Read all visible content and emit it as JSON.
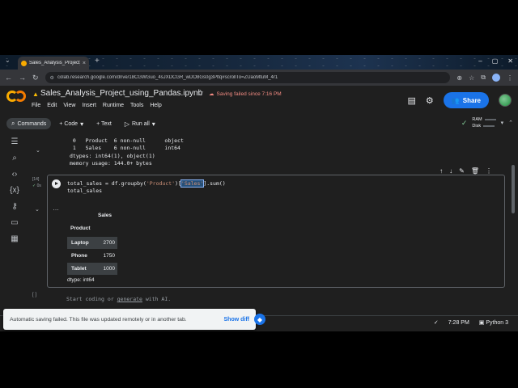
{
  "browser": {
    "tab_title": "Sales_Analysis_Project_using_P",
    "tab_close": "×",
    "new_tab": "+",
    "url": "colab.research.google.com/drive/18CGWGuo_4sJXDCGR_wDO8Gs0g3Pltq#scrollTo=ZUaoMtuM_4r1"
  },
  "header": {
    "notebook_title": "Sales_Analysis_Project_using_Pandas.ipynb",
    "save_status": "Saving failed since 7:16 PM",
    "menu": [
      "File",
      "Edit",
      "View",
      "Insert",
      "Runtime",
      "Tools",
      "Help"
    ],
    "share_label": "Share"
  },
  "toolbar": {
    "commands": "Commands",
    "code": "+ Code",
    "text": "+ Text",
    "run_all": "Run all",
    "ram": "RAM",
    "disk": "Disk"
  },
  "prev_output": {
    "lines": [
      " 0   Product  6 non-null      object",
      " 1   Sales    6 non-null      int64",
      "dtypes: int64(1), object(1)",
      "memory usage: 144.0+ bytes"
    ]
  },
  "cell": {
    "exec_count": "[14]",
    "exec_time": "0s",
    "code_line1_a": "total_sales = df.groupby(",
    "code_line1_b": "'Product'",
    "code_line1_c": ")[",
    "code_line1_d": "'Sales'",
    "code_line1_e": "].sum()",
    "code_line2": "total_sales",
    "output": {
      "header_col": "Sales",
      "index_name": "Product",
      "rows": [
        {
          "k": "Laptop",
          "v": "2700"
        },
        {
          "k": "Phone",
          "v": "1750"
        },
        {
          "k": "Tablet",
          "v": "1000"
        }
      ],
      "dtype": "dtype: int64"
    }
  },
  "new_cell": {
    "bracket": "[ ]",
    "placeholder_a": "Start coding or ",
    "placeholder_link": "generate",
    "placeholder_b": " with AI."
  },
  "toast": {
    "message": "Automatic saving failed. This file was updated remotely or in another tab.",
    "action": "Show diff"
  },
  "status": {
    "time": "7:28 PM",
    "runtime": "Python 3"
  }
}
